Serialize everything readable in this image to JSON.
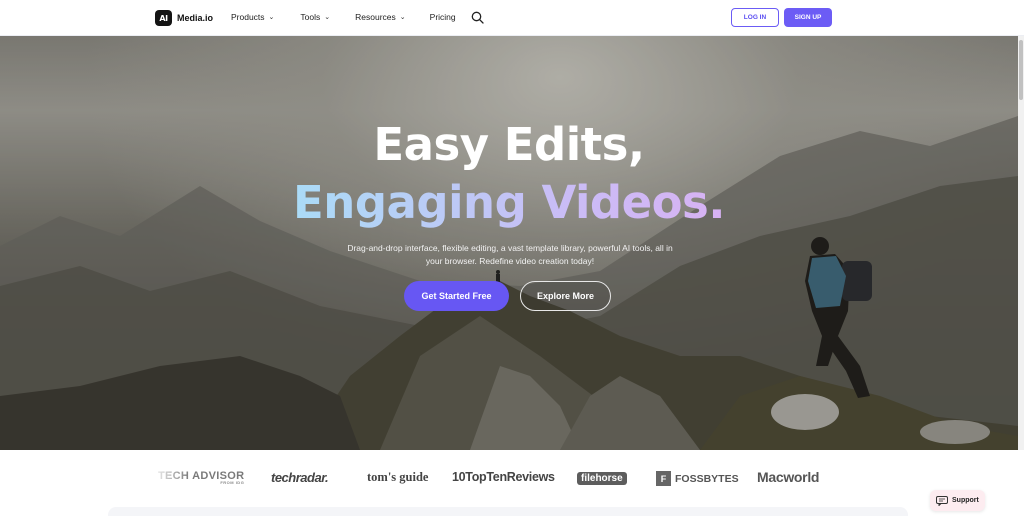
{
  "nav": {
    "logo_badge": "AI",
    "logo_text": "Media.io",
    "menu": [
      {
        "label": "Products",
        "has_dropdown": true
      },
      {
        "label": "Tools",
        "has_dropdown": true
      },
      {
        "label": "Resources",
        "has_dropdown": true
      },
      {
        "label": "Pricing",
        "has_dropdown": false
      }
    ],
    "search_icon": "search-icon",
    "login_label": "LOG IN",
    "signup_label": "SIGN UP"
  },
  "hero": {
    "headline_line1": "Easy Edits,",
    "headline_line2": "Engaging Videos.",
    "subtitle": "Drag-and-drop interface, flexible editing, a vast template library, powerful AI tools, all in your browser. Redefine video creation today!",
    "primary_cta": "Get Started Free",
    "secondary_cta": "Explore More"
  },
  "logos": {
    "items": [
      {
        "name": "TECH ADVISOR",
        "sub": "FROM IDG"
      },
      {
        "name": "techradar."
      },
      {
        "name": "tom's guide"
      },
      {
        "name": "10TopTenReviews"
      },
      {
        "name": "filehorse"
      },
      {
        "name": "FOSSBYTES",
        "badge": "F"
      },
      {
        "name": "Macworld"
      }
    ]
  },
  "support": {
    "label": "Support",
    "icon": "chat-icon"
  },
  "colors": {
    "accent": "#6757f3",
    "gradient_start": "#7ef0f4",
    "gradient_end": "#f3b8f0"
  }
}
